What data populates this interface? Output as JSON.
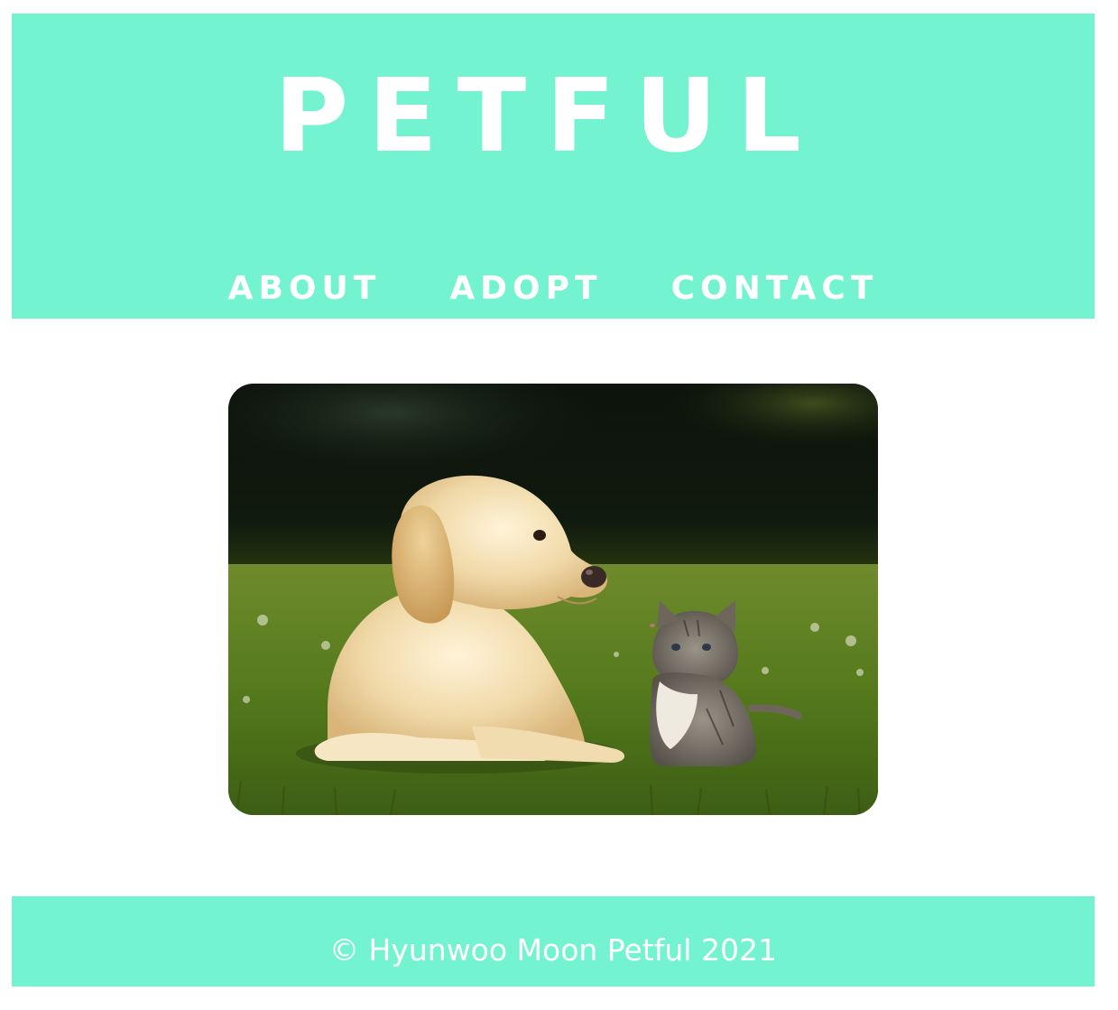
{
  "colors": {
    "brand": "#74f3d1",
    "text_on_brand": "#ffffff"
  },
  "header": {
    "logo": "PETFUL"
  },
  "nav": {
    "items": [
      {
        "label": "ABOUT"
      },
      {
        "label": "ADOPT"
      },
      {
        "label": "CONTACT"
      }
    ]
  },
  "hero": {
    "image_subject": "puppy-and-kitten-on-grass"
  },
  "footer": {
    "copyright": "© Hyunwoo Moon Petful 2021"
  }
}
